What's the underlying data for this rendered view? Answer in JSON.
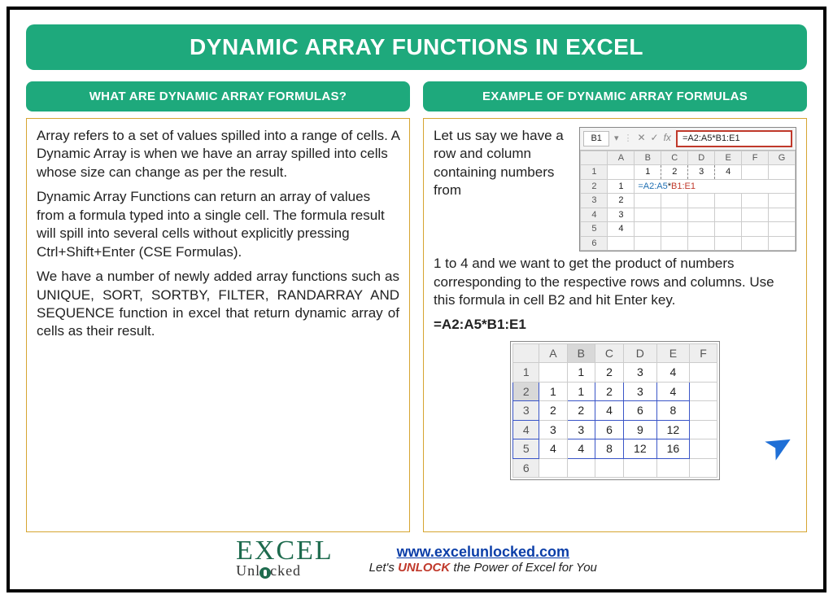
{
  "title": "DYNAMIC ARRAY FUNCTIONS IN EXCEL",
  "left": {
    "heading": "WHAT ARE DYNAMIC ARRAY FORMULAS?",
    "para1": "Array refers to a set of values spilled into a range of cells. A Dynamic Array is when we have an array spilled into cells whose size can change as per the result.",
    "para2": "Dynamic Array Functions can return an array of values from a formula typed into a single cell. The formula result will spill into several cells without explicitly pressing Ctrl+Shift+Enter (CSE Formulas).",
    "para3": "We have a number of newly added array functions such as UNIQUE, SORT, SORTBY, FILTER, RANDARRAY AND SEQUENCE function in excel that return dynamic array of cells as their result."
  },
  "right": {
    "heading": "EXAMPLE OF DYNAMIC ARRAY FORMULAS",
    "intro": "Let us say we have a row and column containing numbers from",
    "intro2": "1 to 4 and we want to get the product of numbers corresponding to the respective rows and columns. Use this formula in cell B2 and hit Enter key.",
    "formula": "=A2:A5*B1:E1",
    "mini_sheet": {
      "namebox": "B1",
      "formula_bar": "=A2:A5*B1:E1",
      "cols": [
        "A",
        "B",
        "C",
        "D",
        "E",
        "F",
        "G"
      ],
      "row1": [
        "",
        "1",
        "2",
        "3",
        "4",
        "",
        ""
      ],
      "row2_lead": "1",
      "row2_formula_blue": "=A2:A5",
      "row2_formula_mid": "*",
      "row2_formula_red": "B1:E1",
      "side_rows": [
        "2",
        "3",
        "4"
      ]
    },
    "result": {
      "cols": [
        "A",
        "B",
        "C",
        "D",
        "E",
        "F"
      ],
      "header_row": [
        "",
        "1",
        "2",
        "3",
        "4",
        ""
      ],
      "rows": [
        {
          "h": "2",
          "lead": "1",
          "vals": [
            "1",
            "2",
            "3",
            "4"
          ]
        },
        {
          "h": "3",
          "lead": "2",
          "vals": [
            "2",
            "4",
            "6",
            "8"
          ]
        },
        {
          "h": "4",
          "lead": "3",
          "vals": [
            "3",
            "6",
            "9",
            "12"
          ]
        },
        {
          "h": "5",
          "lead": "4",
          "vals": [
            "4",
            "8",
            "12",
            "16"
          ]
        }
      ]
    }
  },
  "footer": {
    "logo_top": "EXCEL",
    "logo_bottom": "Unlocked",
    "url": "www.excelunlocked.com",
    "tag_pre": "Let's ",
    "tag_word": "UNLOCK",
    "tag_post": " the Power of Excel for You"
  }
}
